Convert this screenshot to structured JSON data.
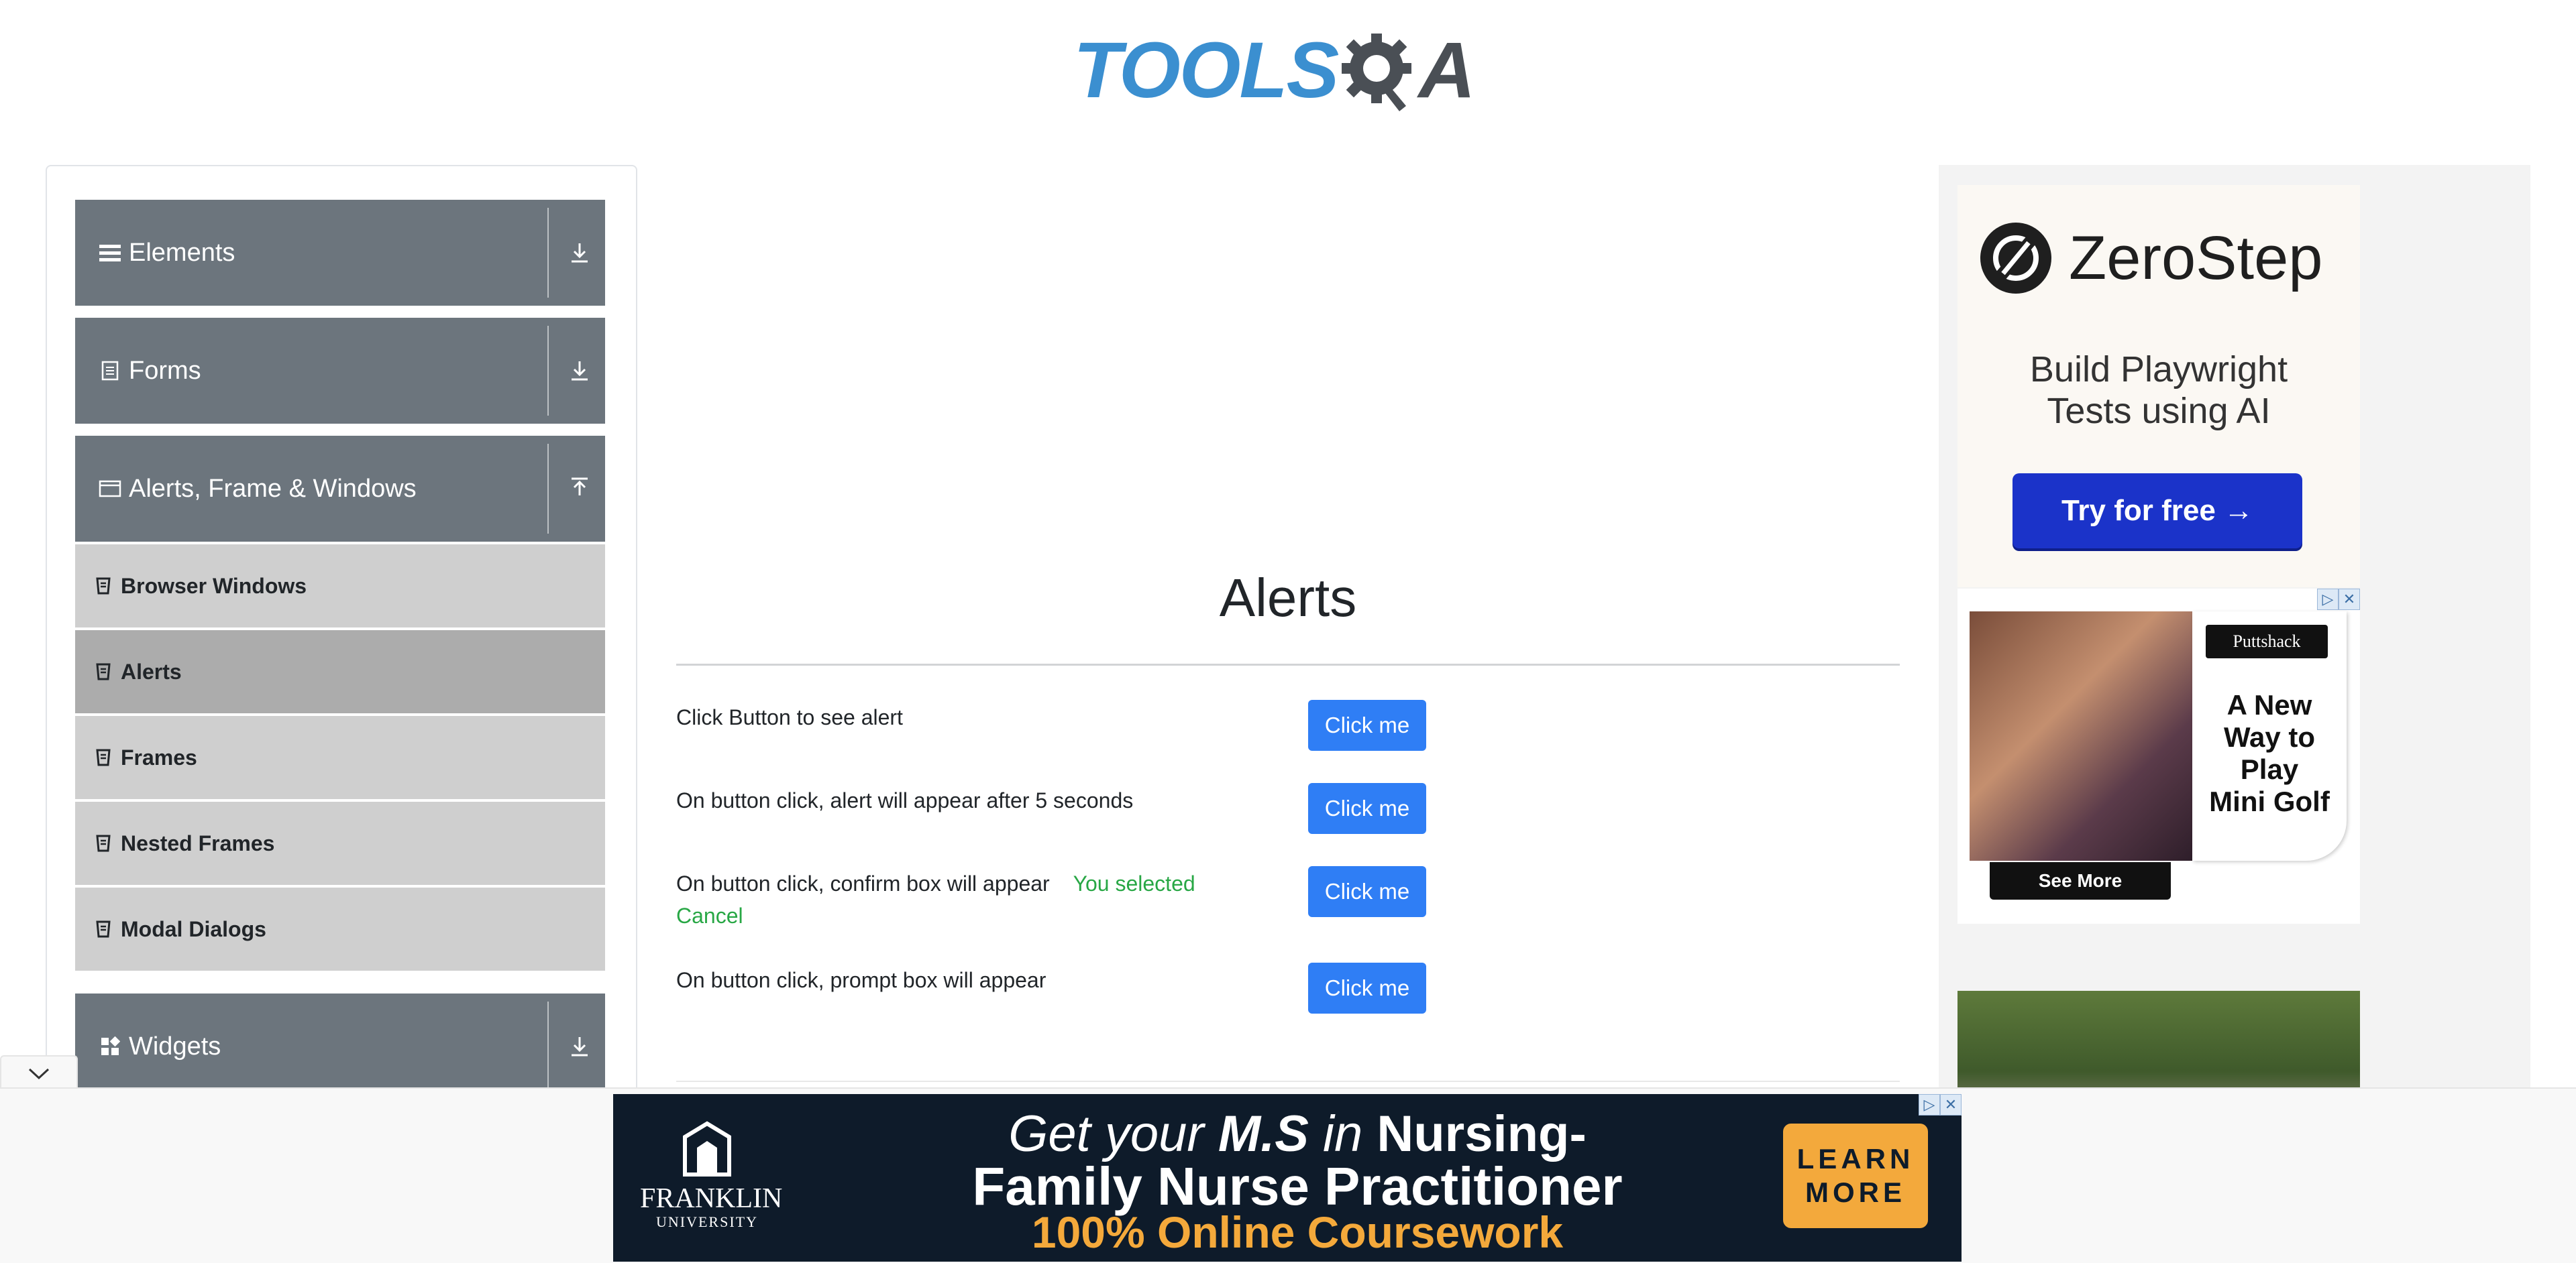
{
  "header": {
    "logo_text": "TOOLSQA",
    "logo_tools": "TOOLS",
    "logo_q": "Q",
    "logo_a": "A"
  },
  "sidebar": {
    "groups": [
      {
        "label": "Elements",
        "icon": "hamburger-icon",
        "state": "collapsed"
      },
      {
        "label": "Forms",
        "icon": "form-icon",
        "state": "collapsed"
      },
      {
        "label": "Alerts, Frame & Windows",
        "icon": "window-icon",
        "state": "expanded"
      },
      {
        "label": "Widgets",
        "icon": "widgets-icon",
        "state": "collapsed"
      }
    ],
    "items": [
      {
        "label": "Browser Windows"
      },
      {
        "label": "Alerts",
        "active": true
      },
      {
        "label": "Frames"
      },
      {
        "label": "Nested Frames"
      },
      {
        "label": "Modal Dialogs"
      }
    ]
  },
  "main": {
    "title": "Alerts",
    "rows": [
      {
        "text": "Click Button to see alert",
        "button": "Click me"
      },
      {
        "text": "On button click, alert will appear after 5 seconds",
        "button": "Click me"
      },
      {
        "text": "On button click, confirm box will appear",
        "result": "You selected Cancel",
        "button": "Click me"
      },
      {
        "text": "On button click, prompt box will appear",
        "button": "Click me"
      }
    ]
  },
  "ads": {
    "zerostep": {
      "name": "ZeroStep",
      "tagline_1": "Build Playwright",
      "tagline_2": "Tests using AI",
      "cta": "Try for free →"
    },
    "puttshack": {
      "brand": "Puttshack",
      "copy_1": "A New",
      "copy_2": "Way to",
      "copy_3": "Play",
      "copy_4": "Mini Golf",
      "cta": "See More"
    },
    "franklin": {
      "school": "FRANKLIN",
      "school_sub": "UNIVERSITY",
      "line1_a": "Get your ",
      "line1_b": "M.S",
      "line1_c": " in ",
      "line1_d": "Nursing-",
      "line2": "Family Nurse Practitioner",
      "line3": "100% Online Coursework",
      "cta_1": "LEARN",
      "cta_2": "MORE"
    }
  },
  "colors": {
    "sidebar_header": "#6c757d",
    "menu_item": "#cfcfcf",
    "menu_active": "#acacac",
    "button": "#2f7ef5",
    "success": "#28a745"
  }
}
